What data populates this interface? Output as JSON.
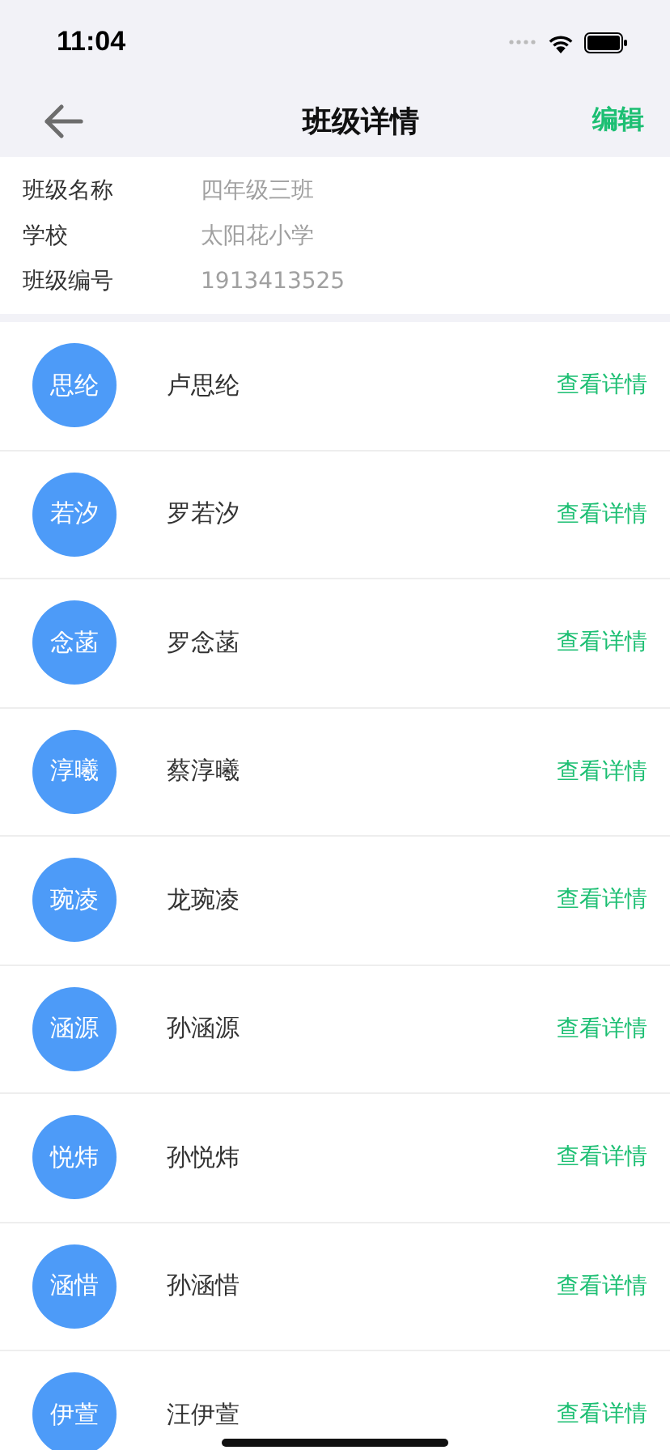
{
  "status_bar": {
    "time": "11:04"
  },
  "nav": {
    "title": "班级详情",
    "action": "编辑"
  },
  "info": [
    {
      "label": "班级名称",
      "value": "四年级三班"
    },
    {
      "label": "学校",
      "value": "太阳花小学"
    },
    {
      "label": "班级编号",
      "value": "1913413525"
    }
  ],
  "students": [
    {
      "avatar": "思纶",
      "name": "卢思纶",
      "link": "查看详情"
    },
    {
      "avatar": "若汐",
      "name": "罗若汐",
      "link": "查看详情"
    },
    {
      "avatar": "念菡",
      "name": "罗念菡",
      "link": "查看详情"
    },
    {
      "avatar": "淳曦",
      "name": "蔡淳曦",
      "link": "查看详情"
    },
    {
      "avatar": "琬凌",
      "name": "龙琬凌",
      "link": "查看详情"
    },
    {
      "avatar": "涵源",
      "name": "孙涵源",
      "link": "查看详情"
    },
    {
      "avatar": "悦炜",
      "name": "孙悦炜",
      "link": "查看详情"
    },
    {
      "avatar": "涵惜",
      "name": "孙涵惜",
      "link": "查看详情"
    },
    {
      "avatar": "伊萱",
      "name": "汪伊萱",
      "link": "查看详情"
    }
  ]
}
